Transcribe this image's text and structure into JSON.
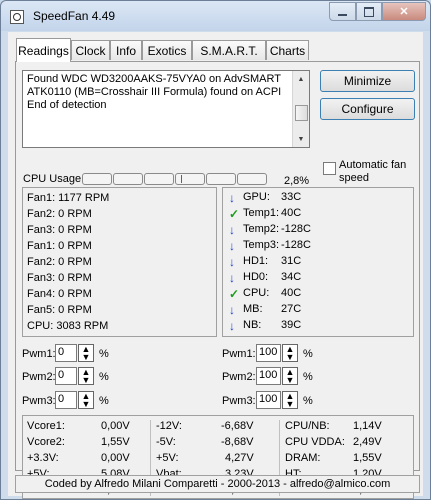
{
  "window": {
    "title": "SpeedFan 4.49"
  },
  "tabs": [
    "Readings",
    "Clock",
    "Info",
    "Exotics",
    "S.M.A.R.T.",
    "Charts"
  ],
  "log": {
    "lines": [
      "Found WDC WD3200AAKS-75VYA0 on AdvSMART",
      "ATK0110 (MB=Crosshair III Formula) found on ACPI",
      "End of detection"
    ]
  },
  "buttons": {
    "minimize": "Minimize",
    "configure": "Configure"
  },
  "auto_fan": {
    "label": "Automatic fan speed",
    "checked": false
  },
  "cpu_usage": {
    "label": "CPU Usage",
    "percent_text": "2,8%",
    "percent": 2.8,
    "segments": 8
  },
  "fans": [
    "Fan1: 1177 RPM",
    "Fan2: 0 RPM",
    "Fan3: 0 RPM",
    "Fan1: 0 RPM",
    "Fan2: 0 RPM",
    "Fan3: 0 RPM",
    "Fan4: 0 RPM",
    "Fan5: 0 RPM",
    "CPU:  3083 RPM"
  ],
  "temps": [
    {
      "label": "GPU:",
      "value": "33C",
      "icon": "arrow-down-icon"
    },
    {
      "label": "Temp1:",
      "value": "40C",
      "icon": "check-icon"
    },
    {
      "label": "Temp2:",
      "value": "-128C",
      "icon": "arrow-down-icon"
    },
    {
      "label": "Temp3:",
      "value": "-128C",
      "icon": "arrow-down-icon"
    },
    {
      "label": "HD1:",
      "value": "31C",
      "icon": "arrow-down-icon"
    },
    {
      "label": "HD0:",
      "value": "34C",
      "icon": "arrow-down-icon"
    },
    {
      "label": "CPU:",
      "value": "40C",
      "icon": "check-icon"
    },
    {
      "label": "MB:",
      "value": "27C",
      "icon": "arrow-down-icon"
    },
    {
      "label": "NB:",
      "value": "39C",
      "icon": "arrow-down-icon"
    }
  ],
  "pwm_left": [
    {
      "label": "Pwm1:",
      "value": "0",
      "unit": "%"
    },
    {
      "label": "Pwm2:",
      "value": "0",
      "unit": "%"
    },
    {
      "label": "Pwm3:",
      "value": "0",
      "unit": "%"
    }
  ],
  "pwm_right": [
    {
      "label": "Pwm1:",
      "value": "100",
      "unit": "%"
    },
    {
      "label": "Pwm2:",
      "value": "100",
      "unit": "%"
    },
    {
      "label": "Pwm3:",
      "value": "100",
      "unit": "%"
    }
  ],
  "voltages": {
    "col1": [
      {
        "label": "Vcore1:",
        "value": "0,00V"
      },
      {
        "label": "Vcore2:",
        "value": "1,55V"
      },
      {
        "label": "+3.3V:",
        "value": "0,00V"
      },
      {
        "label": "+5V:",
        "value": "5,08V"
      },
      {
        "label": "+12V:",
        "value": "3,07V"
      }
    ],
    "col2": [
      {
        "label": "-12V:",
        "value": "-6,68V"
      },
      {
        "label": "-5V:",
        "value": "-8,68V"
      },
      {
        "label": "+5V:",
        "value": "4,27V"
      },
      {
        "label": "Vbat:",
        "value": "3,23V"
      },
      {
        "label": "CPU:",
        "value": "1,21V"
      }
    ],
    "col3": [
      {
        "label": "CPU/NB:",
        "value": "1,14V"
      },
      {
        "label": "CPU VDDA:",
        "value": "2,49V"
      },
      {
        "label": "DRAM:",
        "value": "1,55V"
      },
      {
        "label": "HT:",
        "value": "1,20V"
      },
      {
        "label": "NB:",
        "value": "1,11V"
      }
    ]
  },
  "status": "Coded by Alfredo Milani Comparetti - 2000-2013 - alfredo@almico.com"
}
